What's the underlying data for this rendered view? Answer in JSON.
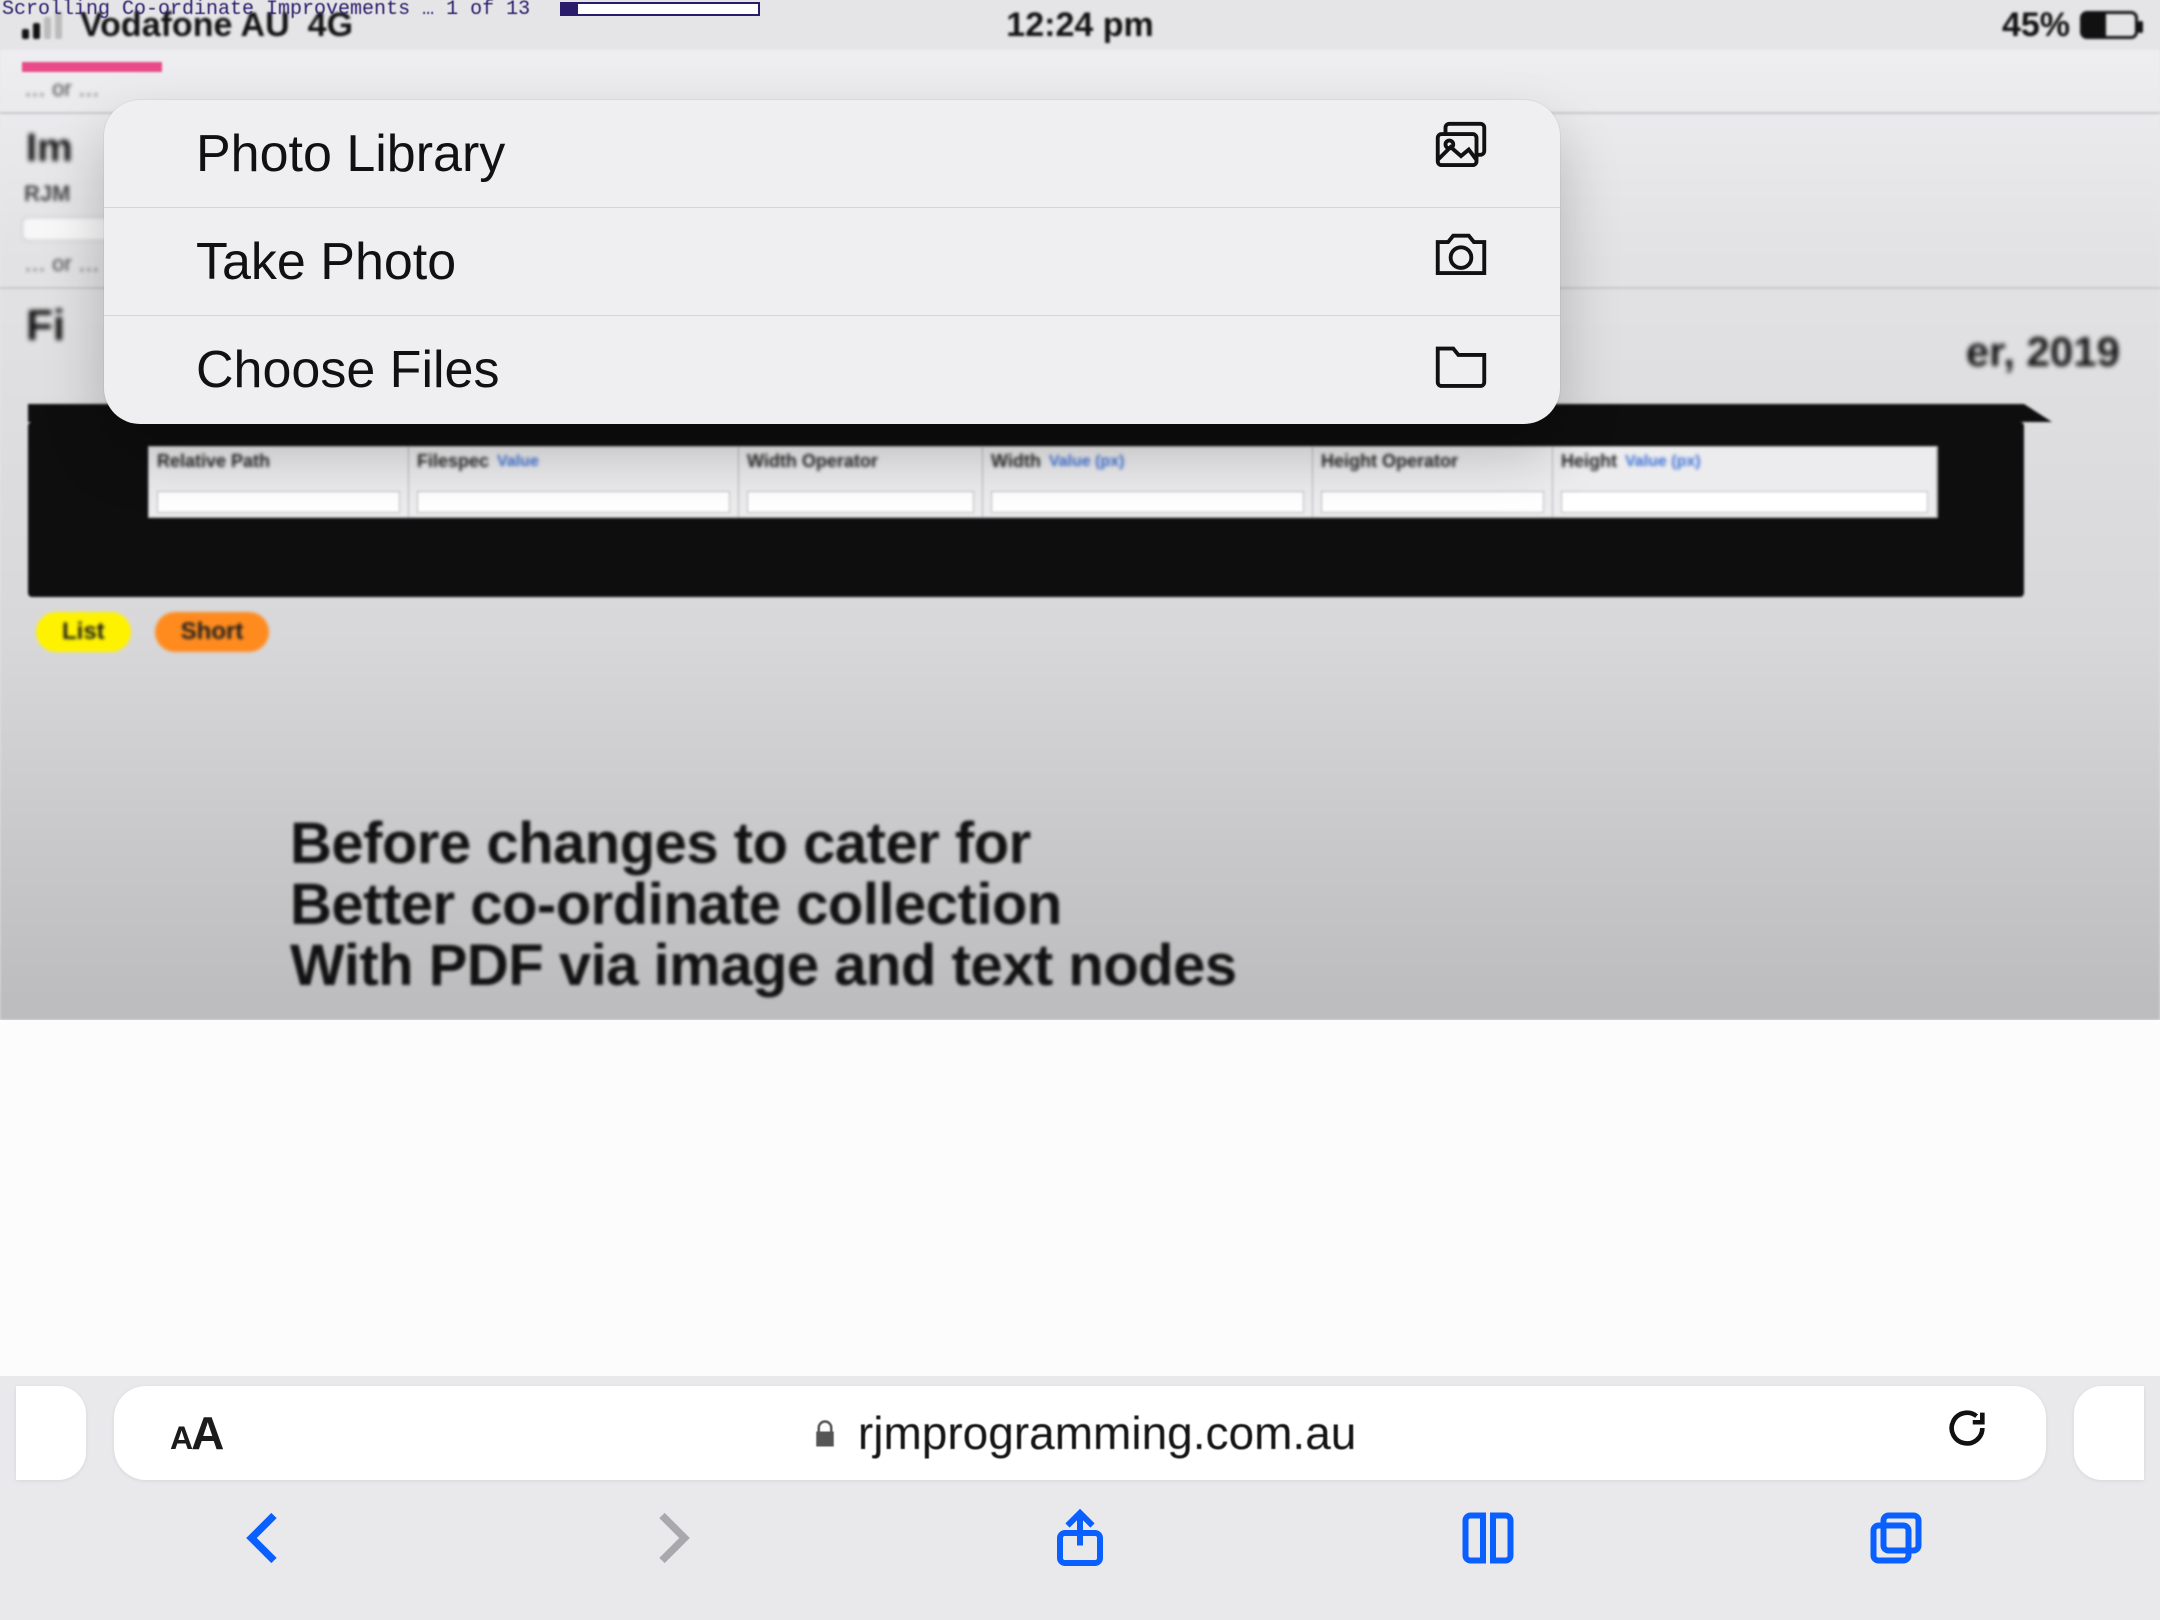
{
  "overlay": {
    "caption": "Scrolling Co-ordinate Improvements … 1 of 13"
  },
  "status": {
    "carrier": "Vodafone AU",
    "network": "4G",
    "time": "12:24 pm",
    "battery_pct": "45%"
  },
  "background": {
    "or1": "… or …",
    "heading_left": "Im",
    "rjm": "RJM",
    "or2": "… or …",
    "fi": "Fi",
    "date_right": "er, 2019",
    "filters": {
      "c1": "Relative Path",
      "c2": "Filespec",
      "c2_val": "Value",
      "c3": "Width Operator",
      "c4": "Width",
      "c4_val": "Value (px)",
      "c5": "Height Operator",
      "c6": "Height",
      "c6_val": "Value (px)"
    },
    "pills": {
      "list": "List",
      "short": "Short"
    },
    "big1": "Before changes to cater for",
    "big2": "Better co-ordinate collection",
    "big3": "With PDF via image and text nodes"
  },
  "popover": {
    "items": [
      {
        "label": "Photo Library",
        "icon": "photo-library"
      },
      {
        "label": "Take Photo",
        "icon": "camera"
      },
      {
        "label": "Choose Files",
        "icon": "folder"
      }
    ]
  },
  "address": {
    "url": "rjmprogramming.com.au"
  }
}
